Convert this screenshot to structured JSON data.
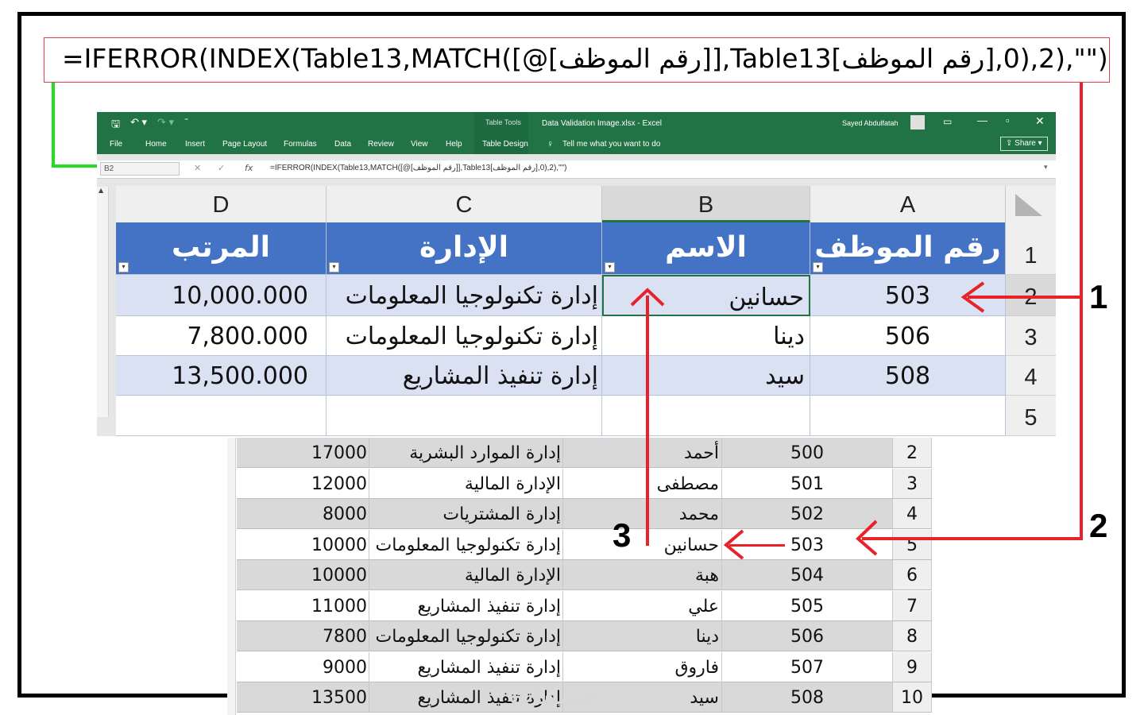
{
  "formula_callout": "=IFERROR(INDEX(Table13,MATCH([@[رقم الموظف]],Table13[رقم الموظف],0),2),\"\")",
  "excel": {
    "title": "Data Validation Image.xlsx - Excel",
    "contextual": "Table Tools",
    "user": "Sayed Abdulfatah",
    "share": "Share",
    "tabs": [
      "File",
      "Home",
      "Insert",
      "Page Layout",
      "Formulas",
      "Data",
      "Review",
      "View",
      "Help",
      "Table Design"
    ],
    "tell_me": "Tell me what you want to do",
    "name_box": "B2",
    "formula_bar": "=IFERROR(INDEX(Table13,MATCH([@[رقم الموظف]],Table13[رقم الموظف],0),2),\"\")",
    "columns": [
      "D",
      "C",
      "B",
      "A"
    ],
    "rows": [
      "1",
      "2",
      "3",
      "4",
      "5"
    ],
    "headers": {
      "salary": "المرتب",
      "dept": "الإدارة",
      "name": "الاسم",
      "id": "رقم الموظف"
    },
    "data": [
      {
        "salary": "10,000.000",
        "dept": "إدارة تكنولوجيا المعلومات",
        "name": "حسانين",
        "id": "503"
      },
      {
        "salary": "7,800.000",
        "dept": "إدارة تكنولوجيا المعلومات",
        "name": "دينا",
        "id": "506"
      },
      {
        "salary": "13,500.000",
        "dept": "إدارة تنفيذ المشاريع",
        "name": "سيد",
        "id": "508"
      }
    ]
  },
  "lookup": {
    "rows": [
      {
        "row": "2",
        "id": "500",
        "name": "أحمد",
        "dept": "إدارة الموارد البشرية",
        "salary": "17000"
      },
      {
        "row": "3",
        "id": "501",
        "name": "مصطفى",
        "dept": "الإدارة المالية",
        "salary": "12000"
      },
      {
        "row": "4",
        "id": "502",
        "name": "محمد",
        "dept": "إدارة المشتريات",
        "salary": "8000"
      },
      {
        "row": "5",
        "id": "503",
        "name": "حسانين",
        "dept": "إدارة تكنولوجيا المعلومات",
        "salary": "10000"
      },
      {
        "row": "6",
        "id": "504",
        "name": "هبة",
        "dept": "الإدارة المالية",
        "salary": "10000"
      },
      {
        "row": "7",
        "id": "505",
        "name": "علي",
        "dept": "إدارة تنفيذ المشاريع",
        "salary": "11000"
      },
      {
        "row": "8",
        "id": "506",
        "name": "دينا",
        "dept": "إدارة تكنولوجيا المعلومات",
        "salary": "7800"
      },
      {
        "row": "9",
        "id": "507",
        "name": "فاروق",
        "dept": "إدارة تنفيذ المشاريع",
        "salary": "9000"
      },
      {
        "row": "10",
        "id": "508",
        "name": "سيد",
        "dept": "إدارة تنفيذ المشاريع",
        "salary": "13500"
      }
    ]
  },
  "annotations": {
    "one": "1",
    "two": "2",
    "three": "3"
  },
  "watermark": "خمسات",
  "colors": {
    "ribbon": "#217346",
    "header": "#4472c4",
    "band": "#d9e1f2",
    "arrow": "#e8222a",
    "guide": "#22dd22"
  }
}
